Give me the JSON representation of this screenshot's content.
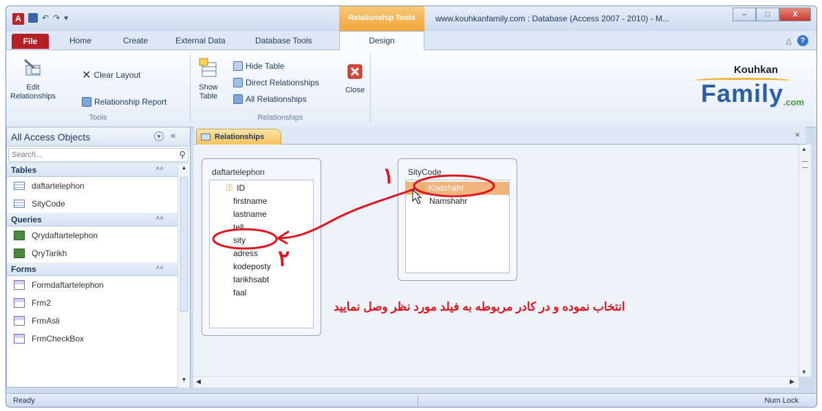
{
  "titlebar": {
    "app_icon": "A",
    "quick_access": [
      "save-icon",
      "undo-icon",
      "redo-icon",
      "customize-icon"
    ],
    "contextual_tab": "Relationship Tools",
    "title": "www.kouhkanfamily.com : Database (Access 2007 - 2010) - M...",
    "controls": {
      "minimize": "–",
      "maximize": "□",
      "close": "X"
    }
  },
  "ribbon_tabs": {
    "file": "File",
    "home": "Home",
    "create": "Create",
    "external_data": "External Data",
    "database_tools": "Database Tools",
    "design": "Design"
  },
  "ribbon": {
    "tools_group": {
      "label": "Tools",
      "edit_relationships": "Edit Relationships",
      "clear_layout": "Clear Layout",
      "relationship_report": "Relationship Report"
    },
    "relationships_group": {
      "label": "Relationships",
      "show_table": "Show Table",
      "hide_table": "Hide Table",
      "direct_relationships": "Direct Relationships",
      "all_relationships": "All Relationships",
      "close": "Close"
    }
  },
  "logo": {
    "top": "Kouhkan",
    "main": "Family",
    "suffix": ".com"
  },
  "nav": {
    "title": "All Access Objects",
    "search_placeholder": "Search...",
    "categories": [
      {
        "label": "Tables",
        "items": [
          "daftartelephon",
          "SityCode"
        ]
      },
      {
        "label": "Queries",
        "items": [
          "Qrydaftartelephon",
          "QryTarikh"
        ]
      },
      {
        "label": "Forms",
        "items": [
          "Formdaftartelephon",
          "Frm2",
          "FrmAsli",
          "FrmCheckBox"
        ]
      }
    ]
  },
  "document": {
    "tab_label": "Relationships",
    "close": "×"
  },
  "tables": {
    "daftartelephon": {
      "title": "daftartelephon",
      "fields": [
        "ID",
        "firstname",
        "lastname",
        "tell",
        "sity",
        "adress",
        "kodeposty",
        "tarikhsabt",
        "faal"
      ]
    },
    "sitycode": {
      "title": "SityCode",
      "fields": [
        "Kodshahr",
        "Namshahr"
      ]
    }
  },
  "annotations": {
    "instruction": "انتخاب نموده و در کادر مربوطه به فیلد مورد نظر وصل نمایید",
    "step1": "۱",
    "step2": "۲",
    "accent_color": "#e0141e"
  },
  "status": {
    "left": "Ready",
    "right": "Num Lock"
  }
}
